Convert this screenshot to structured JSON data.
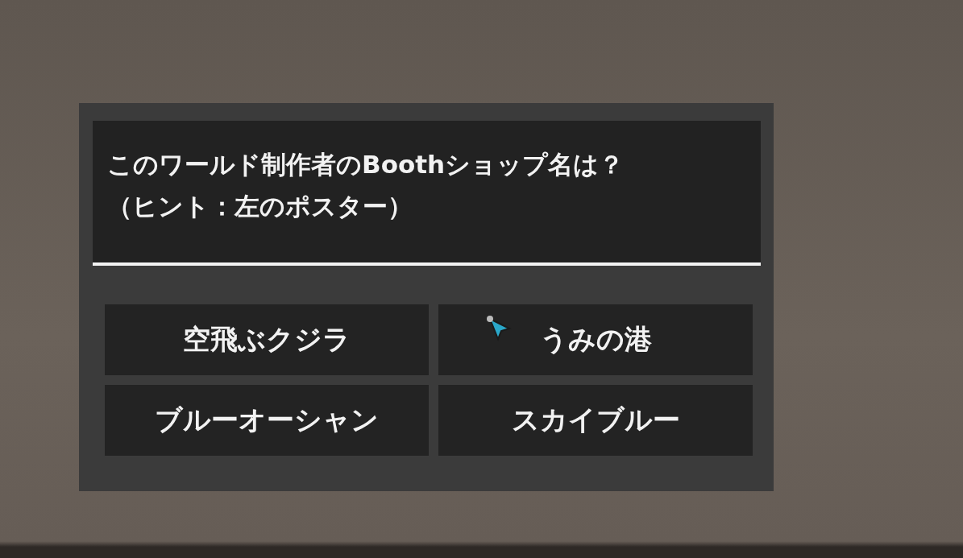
{
  "question_lines": [
    "このワールド制作者のBoothショップ名は？",
    "（ヒント：左のポスター）"
  ],
  "options": [
    {
      "label": "空飛ぶクジラ"
    },
    {
      "label": "うみの港"
    },
    {
      "label": "ブルーオーシャン"
    },
    {
      "label": "スカイブルー"
    }
  ]
}
